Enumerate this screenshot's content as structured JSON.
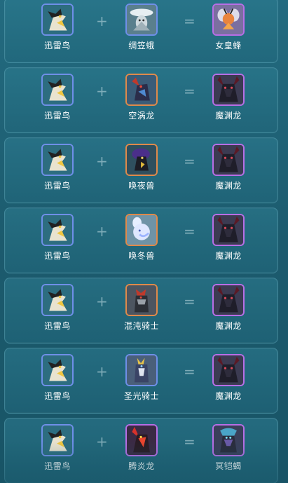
{
  "operators": {
    "plus": "+",
    "equals": "="
  },
  "rows": [
    {
      "a": {
        "name": "迅雷鸟",
        "icon": "thunder-bird-icon",
        "frame": "blue"
      },
      "b": {
        "name": "绸笠蛾",
        "icon": "silk-moth-icon",
        "frame": "blue"
      },
      "result": {
        "name": "女皇蜂",
        "icon": "queen-bee-icon",
        "frame": "purple"
      }
    },
    {
      "a": {
        "name": "迅雷鸟",
        "icon": "thunder-bird-icon",
        "frame": "blue"
      },
      "b": {
        "name": "空涡龙",
        "icon": "vortex-dragon-icon",
        "frame": "orange"
      },
      "result": {
        "name": "魔渊龙",
        "icon": "abyss-dragon-icon",
        "frame": "purple"
      }
    },
    {
      "a": {
        "name": "迅雷鸟",
        "icon": "thunder-bird-icon",
        "frame": "blue"
      },
      "b": {
        "name": "唤夜兽",
        "icon": "night-beast-icon",
        "frame": "orange"
      },
      "result": {
        "name": "魔渊龙",
        "icon": "abyss-dragon-icon",
        "frame": "purple"
      }
    },
    {
      "a": {
        "name": "迅雷鸟",
        "icon": "thunder-bird-icon",
        "frame": "blue"
      },
      "b": {
        "name": "唤冬兽",
        "icon": "winter-beast-icon",
        "frame": "orange"
      },
      "result": {
        "name": "魔渊龙",
        "icon": "abyss-dragon-icon",
        "frame": "purple"
      }
    },
    {
      "a": {
        "name": "迅雷鸟",
        "icon": "thunder-bird-icon",
        "frame": "blue"
      },
      "b": {
        "name": "混沌骑士",
        "icon": "chaos-knight-icon",
        "frame": "orange"
      },
      "result": {
        "name": "魔渊龙",
        "icon": "abyss-dragon-icon",
        "frame": "purple"
      }
    },
    {
      "a": {
        "name": "迅雷鸟",
        "icon": "thunder-bird-icon",
        "frame": "blue"
      },
      "b": {
        "name": "圣光骑士",
        "icon": "holy-knight-icon",
        "frame": "blue"
      },
      "result": {
        "name": "魔渊龙",
        "icon": "abyss-dragon-icon",
        "frame": "purple"
      }
    },
    {
      "a": {
        "name": "迅雷鸟",
        "icon": "thunder-bird-icon",
        "frame": "blue"
      },
      "b": {
        "name": "腾炎龙",
        "icon": "flame-dragon-icon",
        "frame": "purple"
      },
      "result": {
        "name": "冥铠蝎",
        "icon": "underworld-scorpion-icon",
        "frame": "purple"
      }
    }
  ],
  "colors": {
    "background": "#1f5f72",
    "frame_blue": "#6f8fe8",
    "frame_orange": "#e08a4a",
    "frame_purple": "#b86ee6",
    "text": "#ffffff"
  }
}
